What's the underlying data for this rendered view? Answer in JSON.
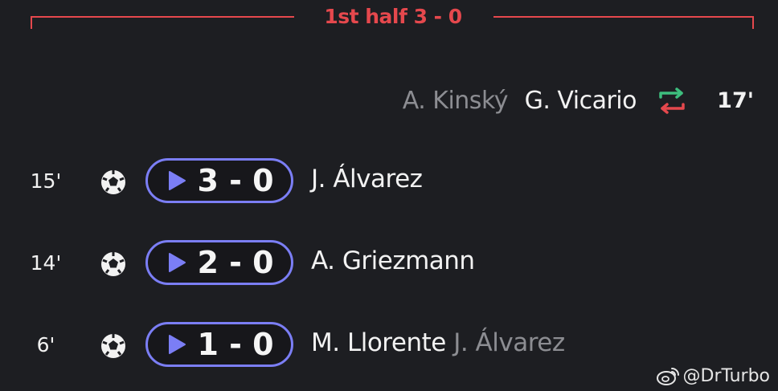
{
  "header": {
    "title": "1st half 3 - 0",
    "accent_color": "#e5484d"
  },
  "substitution": {
    "player_out": "A. Kinský",
    "player_in": "G. Vicario",
    "minute": "17'",
    "icon": "swap-arrows-icon"
  },
  "goals": [
    {
      "minute": "15'",
      "score": "3 - 0",
      "scorer": "J. Álvarez",
      "assist": ""
    },
    {
      "minute": "14'",
      "score": "2 - 0",
      "scorer": "A. Griezmann",
      "assist": ""
    },
    {
      "minute": "6'",
      "score": "1 - 0",
      "scorer": "M. Llorente",
      "assist": "J. Álvarez"
    }
  ],
  "colors": {
    "background": "#1d1e22",
    "pill_border": "#7b7ef5",
    "sub_in_arrow": "#3dbd7d",
    "sub_out_arrow": "#e5484d",
    "muted_text": "#8c8d92"
  },
  "watermark": {
    "text": "@DrTurbo",
    "icon": "weibo-icon"
  }
}
